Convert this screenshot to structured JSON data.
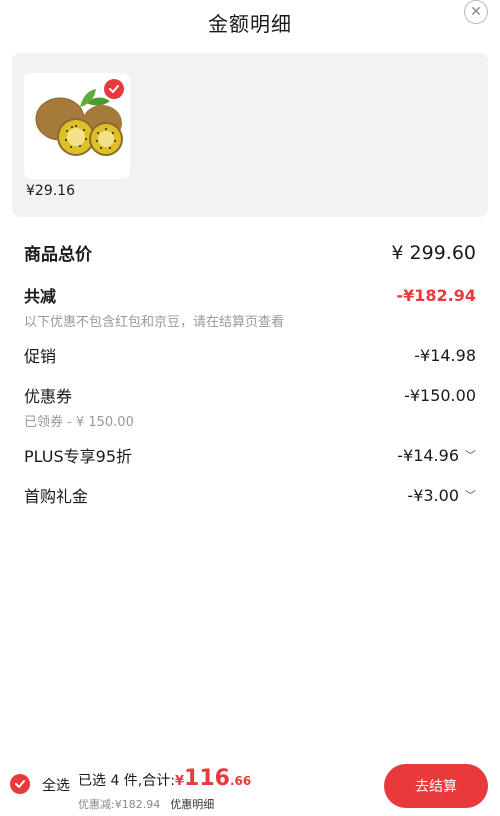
{
  "header": {
    "title": "金额明细"
  },
  "product": {
    "price": "¥29.16"
  },
  "breakdown": {
    "total_label": "商品总价",
    "total_value": "¥ 299.60",
    "discount_label": "共减",
    "discount_value": "-¥182.94",
    "discount_note": "以下优惠不包含红包和京豆，请在结算页查看",
    "promo_label": "促销",
    "promo_value": "-¥14.98",
    "coupon_label": "优惠券",
    "coupon_value": "-¥150.00",
    "coupon_note": "已领券 - ¥ 150.00",
    "plus_label": "PLUS专享95折",
    "plus_value": "-¥14.96",
    "firstbuy_label": "首购礼金",
    "firstbuy_value": "-¥3.00"
  },
  "footer": {
    "select_all": "全选",
    "selected_text": "已选 4 件,合计:",
    "yen": "¥",
    "amount_int": "116",
    "amount_dec": ".66",
    "discount_text": "优惠减:¥182.94",
    "detail_link": "优惠明细",
    "checkout": "去结算"
  },
  "colors": {
    "accent": "#e83a3a",
    "panel": "#f2f2f2"
  },
  "icons": {
    "close": "close-icon",
    "check": "check-icon",
    "chevron": "chevron-down-icon"
  }
}
